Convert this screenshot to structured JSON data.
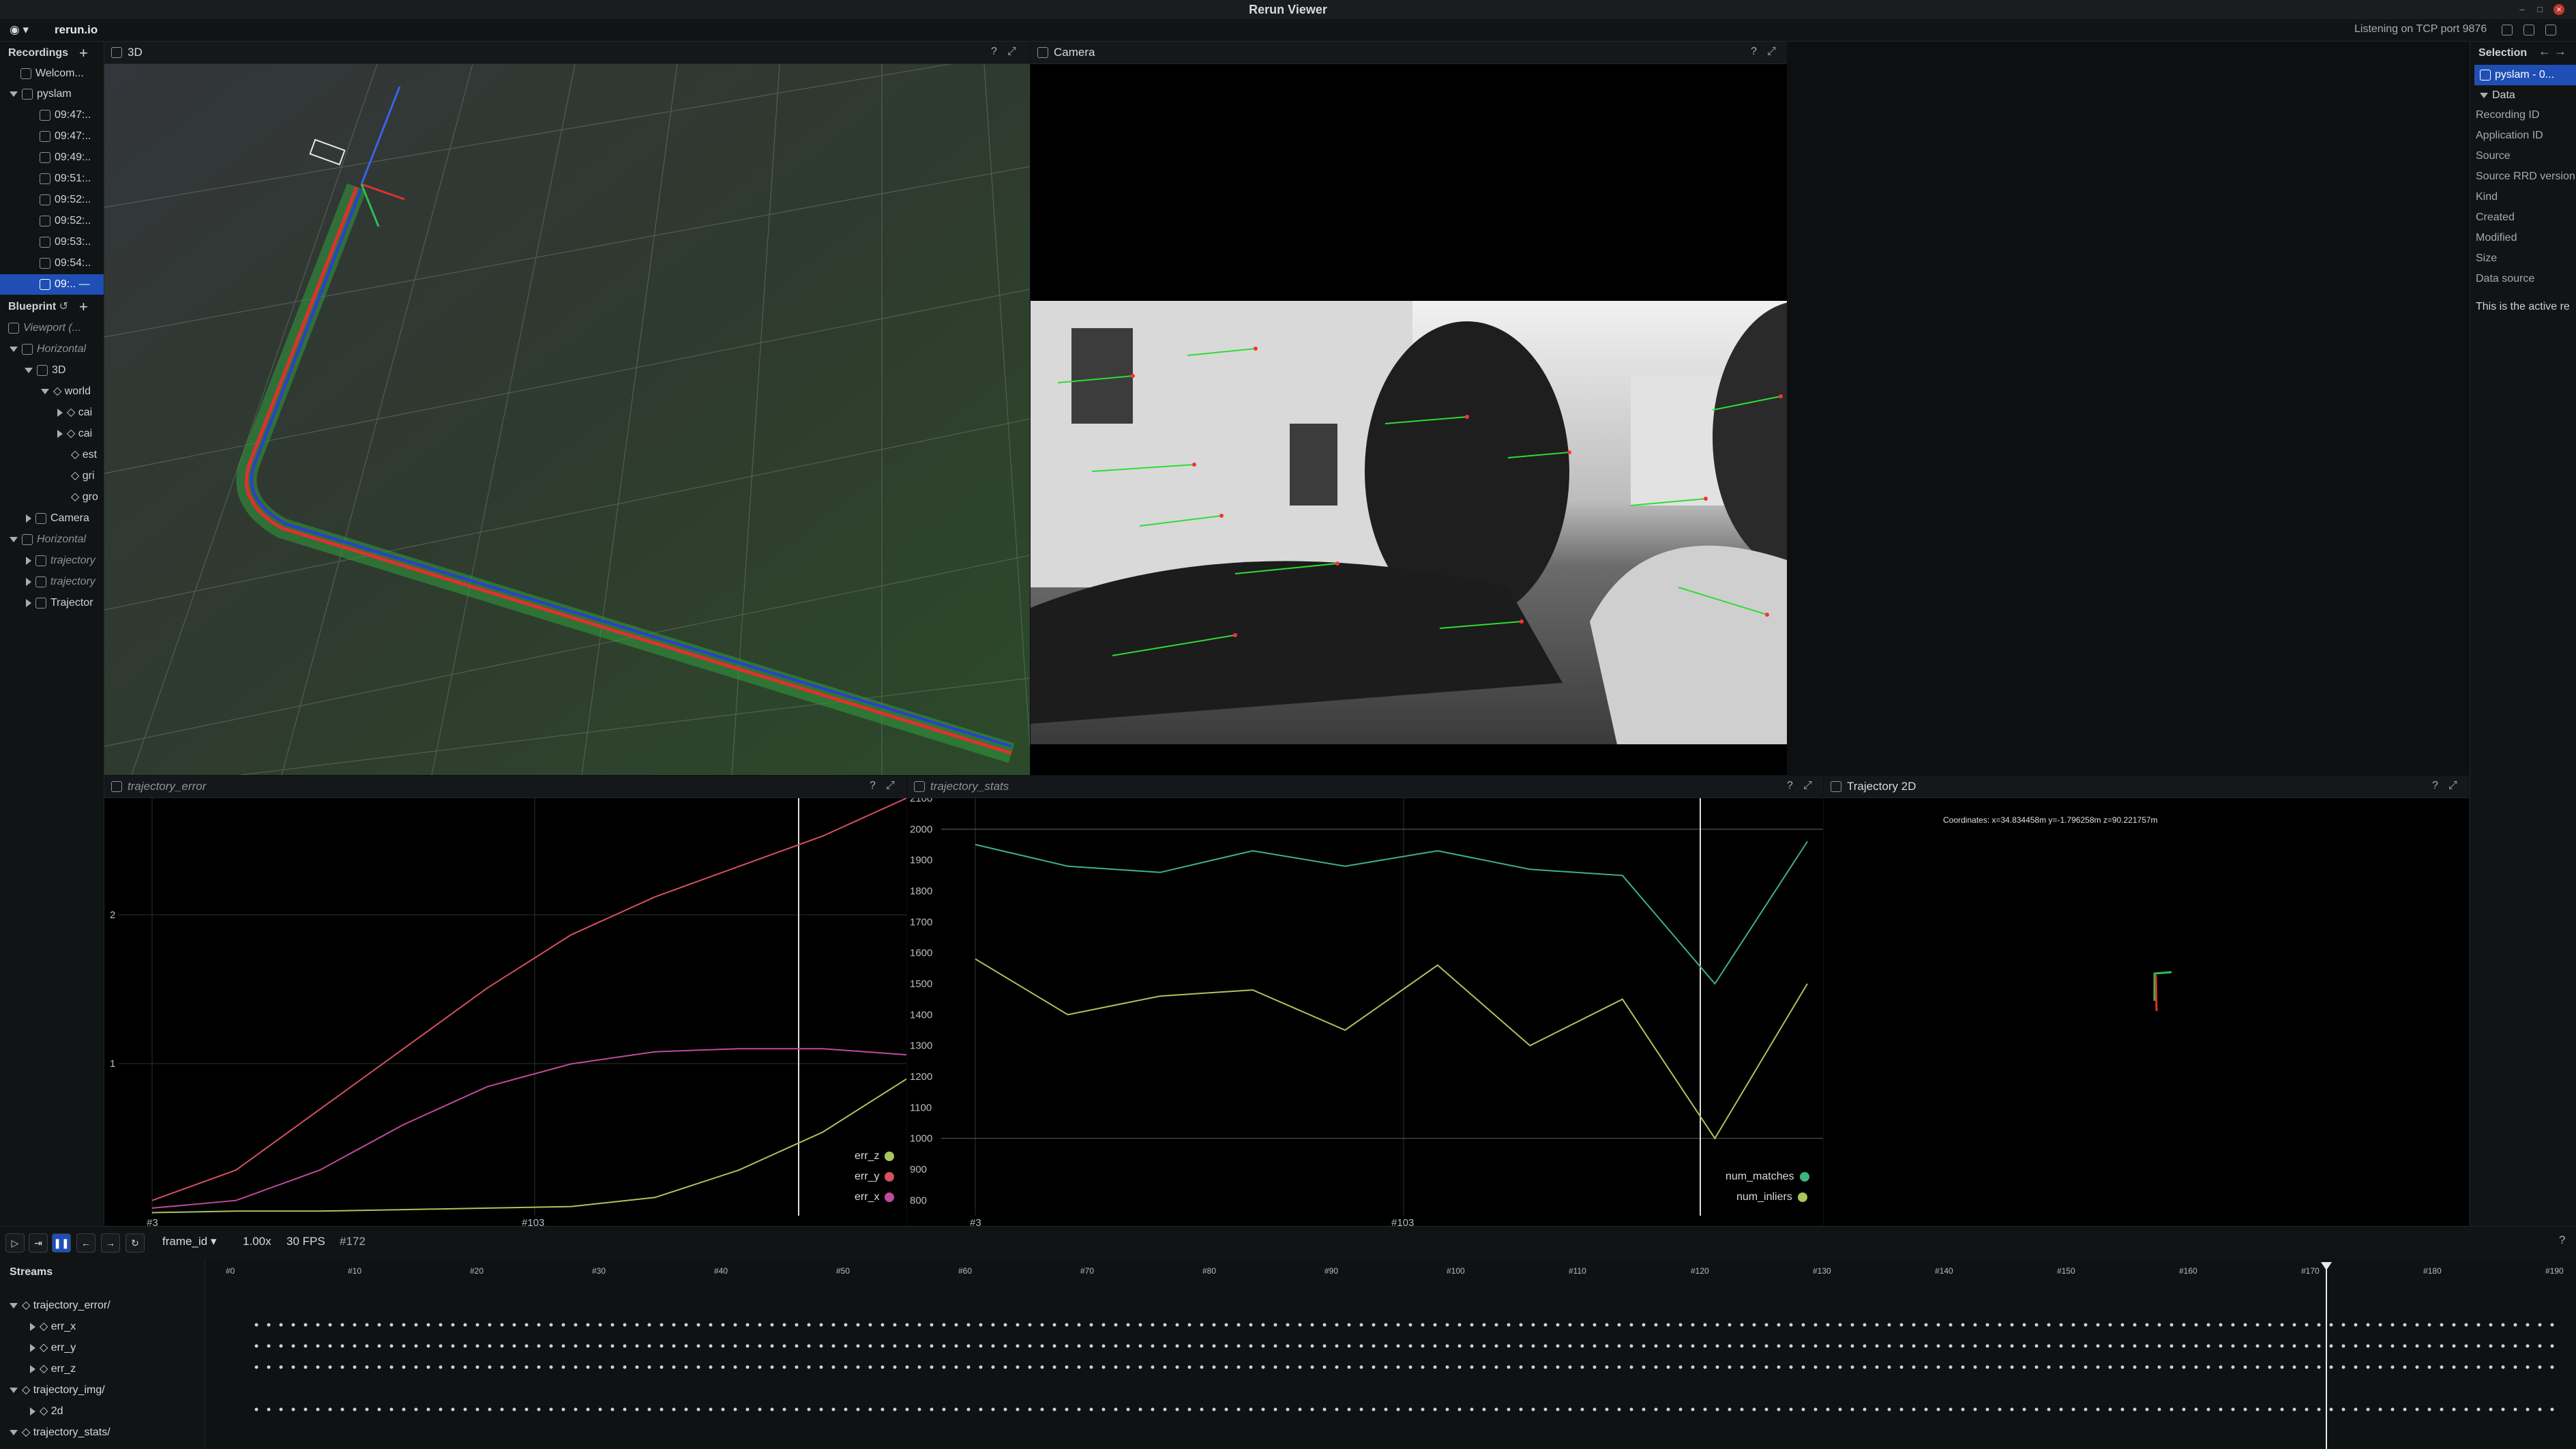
{
  "window": {
    "title": "Rerun Viewer"
  },
  "topbar": {
    "app_name": "rerun.io",
    "status": "Listening on TCP port 9876"
  },
  "recordings": {
    "header": "Recordings",
    "welcome": "Welcom...",
    "app": "pyslam",
    "items": [
      "09:47:..",
      "09:47:..",
      "09:49:..",
      "09:51:..",
      "09:52:..",
      "09:52:..",
      "09:53:..",
      "09:54:..",
      "09:.."
    ]
  },
  "blueprint": {
    "header": "Blueprint",
    "viewport": "Viewport (...",
    "horizontal1": "Horizontal",
    "view3d": "3D",
    "world": "world",
    "children": [
      "cai",
      "cai",
      "est",
      "gri",
      "gro"
    ],
    "camera": "Camera",
    "horizontal2": "Horizontal",
    "traj_error": "trajectory",
    "traj_stats": "trajectory",
    "traj2d": "Trajector"
  },
  "views": {
    "v3d": "3D",
    "camera": "Camera",
    "traj_error": "trajectory_error",
    "traj_stats": "trajectory_stats",
    "traj2d": "Trajectory 2D",
    "traj2d_coords": "Coordinates: x=34.834458m y=-1.796258m z=90.221757m"
  },
  "error_plot": {
    "y_ticks": [
      "2",
      "1"
    ],
    "x_ticks": [
      "#3",
      "#103"
    ],
    "legend": [
      {
        "name": "err_z",
        "color": "#a9c65a"
      },
      {
        "name": "err_y",
        "color": "#d4515f"
      },
      {
        "name": "err_x",
        "color": "#c04a9c"
      }
    ]
  },
  "stats_plot": {
    "y_ticks": [
      "2100",
      "2000",
      "1900",
      "1800",
      "1700",
      "1600",
      "1500",
      "1400",
      "1300",
      "1200",
      "1100",
      "1000",
      "900",
      "800"
    ],
    "x_ticks": [
      "#3",
      "#103"
    ],
    "legend": [
      {
        "name": "num_matches",
        "color": "#3fb37f"
      },
      {
        "name": "num_inliers",
        "color": "#a9c65a"
      }
    ]
  },
  "chart_data": [
    {
      "type": "line",
      "x": [
        3,
        23,
        43,
        63,
        83,
        103,
        123,
        143,
        163,
        183
      ],
      "series": [
        {
          "name": "err_x",
          "values": [
            0.05,
            0.1,
            0.3,
            0.6,
            0.85,
            1.0,
            1.08,
            1.1,
            1.1,
            1.06
          ]
        },
        {
          "name": "err_y",
          "values": [
            0.1,
            0.3,
            0.7,
            1.1,
            1.5,
            1.85,
            2.1,
            2.3,
            2.5,
            2.75
          ]
        },
        {
          "name": "err_z",
          "values": [
            0.02,
            0.03,
            0.03,
            0.04,
            0.05,
            0.06,
            0.12,
            0.3,
            0.55,
            0.9
          ]
        }
      ],
      "ylim": [
        0,
        2.75
      ]
    },
    {
      "type": "line",
      "x": [
        3,
        23,
        43,
        63,
        83,
        103,
        123,
        143,
        163,
        183
      ],
      "series": [
        {
          "name": "num_matches",
          "values": [
            1950,
            1880,
            1860,
            1930,
            1880,
            1930,
            1870,
            1850,
            1500,
            1960
          ]
        },
        {
          "name": "num_inliers",
          "values": [
            1580,
            1400,
            1460,
            1480,
            1350,
            1560,
            1300,
            1450,
            1000,
            1500
          ]
        }
      ],
      "ylim": [
        750,
        2100
      ]
    }
  ],
  "playback": {
    "timeline": "frame_id",
    "speed": "1.00x",
    "fps": "30 FPS",
    "current": "#172"
  },
  "streams": {
    "header": "Streams",
    "rows": [
      "trajectory_error/",
      "err_x",
      "err_y",
      "err_z",
      "trajectory_img/",
      "2d",
      "trajectory_stats/"
    ],
    "ticks": [
      "#0",
      "#10",
      "#20",
      "#30",
      "#40",
      "#50",
      "#60",
      "#70",
      "#80",
      "#90",
      "#100",
      "#110",
      "#120",
      "#130",
      "#140",
      "#150",
      "#160",
      "#170",
      "#180",
      "#190"
    ]
  },
  "selection": {
    "header": "Selection",
    "item": "pyslam - 0...",
    "section": "Data",
    "fields": [
      "Recording ID",
      "Application ID",
      "Source",
      "Source RRD version",
      "Kind",
      "Created",
      "Modified",
      "Size",
      "Data source"
    ],
    "note": "This is the active re"
  }
}
